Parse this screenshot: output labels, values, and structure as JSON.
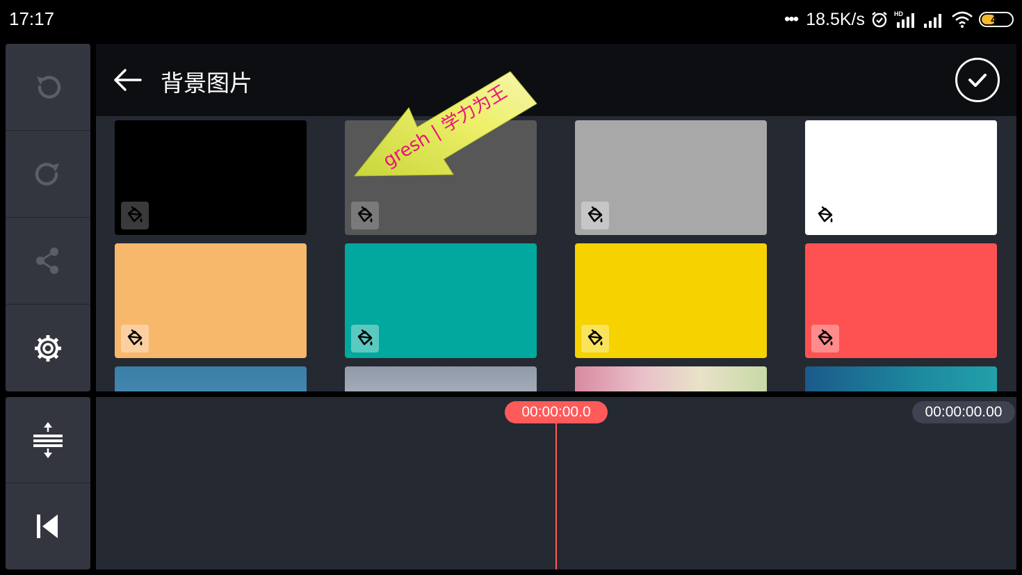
{
  "status_bar": {
    "time": "17:17",
    "dots": "•••",
    "speed": "18.5K/s",
    "battery_level": "44",
    "battery_fraction": 0.44
  },
  "left_toolbar": {
    "items": [
      {
        "name": "undo",
        "icon": "undo-icon"
      },
      {
        "name": "redo",
        "icon": "redo-icon"
      },
      {
        "name": "share",
        "icon": "share-icon"
      },
      {
        "name": "settings",
        "icon": "gear-icon"
      }
    ],
    "bottom_items": [
      {
        "name": "expand-tracks",
        "icon": "expand-tracks-icon"
      },
      {
        "name": "go-to-start",
        "icon": "skip-to-start-icon"
      }
    ]
  },
  "panel": {
    "title": "背景图片",
    "back_icon": "back-arrow-icon",
    "confirm_icon": "checkmark-icon"
  },
  "tiles": [
    {
      "name": "color-black",
      "color": "#000000",
      "badge_bg": "#3a3a3a"
    },
    {
      "name": "color-dark-gray",
      "color": "#575757",
      "badge_bg": "#7a7a7a"
    },
    {
      "name": "color-light-gray",
      "color": "#a8a8a8",
      "badge_bg": "#c6c6c6"
    },
    {
      "name": "color-white",
      "color": "#ffffff",
      "badge_bg": "#ffffff"
    },
    {
      "name": "color-orange",
      "color": "#f8b86b",
      "badge_bg": "#fbd0a0"
    },
    {
      "name": "color-teal",
      "color": "#01a89d",
      "badge_bg": "#5cc9c1"
    },
    {
      "name": "color-yellow",
      "color": "#f6d200",
      "badge_bg": "#f9e35c"
    },
    {
      "name": "color-red",
      "color": "#fe5252",
      "badge_bg": "#fe8c8c"
    },
    {
      "name": "image-sky",
      "gradient": "linear-gradient(180deg,#3a7fa8,#5f9fbf)"
    },
    {
      "name": "image-clouds",
      "gradient": "linear-gradient(180deg,#8f9aa8,#c5cad2 60%,#7c8896)"
    },
    {
      "name": "image-bokeh",
      "gradient": "linear-gradient(90deg,#d98aa0,#e9c0c9 35%,#e8e2c8 65%,#c8d9a6)"
    },
    {
      "name": "image-ocean",
      "gradient": "linear-gradient(90deg,#1b5a8a,#1d8aa0 60%,#22a0a8)"
    }
  ],
  "watermark": {
    "text": "gresh | 学力为王",
    "color": "#e8137a"
  },
  "timeline": {
    "playhead_time": "00:00:00.0",
    "duration": "00:00:00.00"
  }
}
